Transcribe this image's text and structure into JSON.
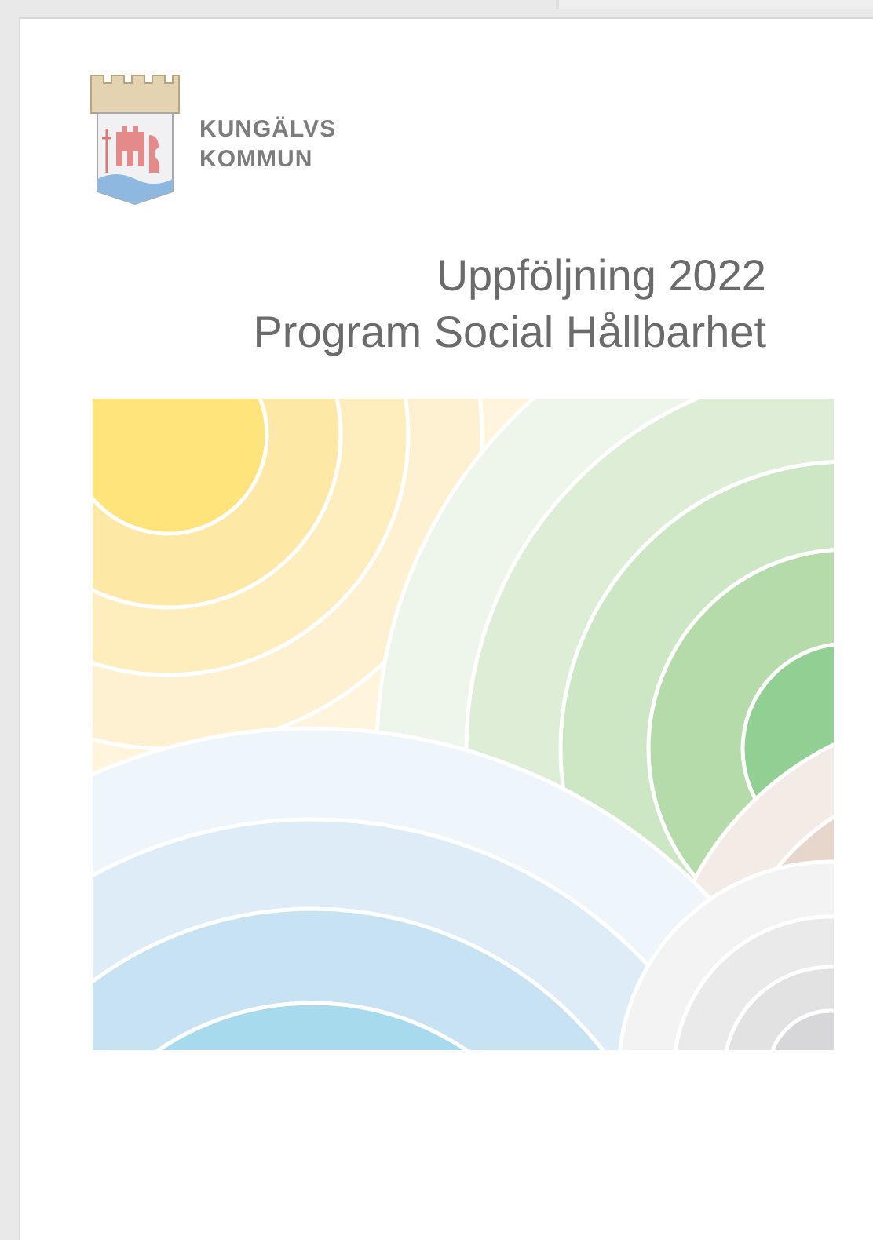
{
  "logo": {
    "lines": [
      "KUNGÄLVS",
      "KOMMUN"
    ]
  },
  "title_lines": [
    "Uppföljning 2022",
    "Program Social Hållbarhet"
  ]
}
